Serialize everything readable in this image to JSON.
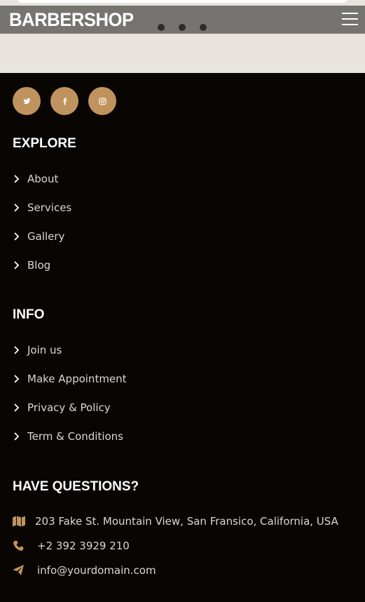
{
  "header": {
    "brand": "BARBERSHOP",
    "menu_icon": "hamburger-menu-icon"
  },
  "carousel": {
    "dot_count": 3
  },
  "footer": {
    "social": [
      {
        "name": "twitter",
        "icon": "twitter-icon"
      },
      {
        "name": "facebook",
        "icon": "facebook-icon"
      },
      {
        "name": "instagram",
        "icon": "instagram-icon"
      }
    ],
    "explore": {
      "title": "EXPLORE",
      "items": [
        {
          "label": "About"
        },
        {
          "label": "Services"
        },
        {
          "label": "Gallery"
        },
        {
          "label": "Blog"
        }
      ]
    },
    "info": {
      "title": "INFO",
      "items": [
        {
          "label": "Join us"
        },
        {
          "label": "Make Appointment"
        },
        {
          "label": "Privacy & Policy"
        },
        {
          "label": "Term & Conditions"
        }
      ]
    },
    "questions": {
      "title": "HAVE QUESTIONS?",
      "address": "203 Fake St. Mountain View, San Fransico, California, USA",
      "phone": "+2 392 3929 210",
      "email": "info@yourdomain.com"
    }
  },
  "colors": {
    "footer_bg": "#080502",
    "accent": "#c0935e",
    "header_bg": "#767471",
    "top_bg": "#e8e4dd",
    "link_text": "#dcd7d1"
  }
}
